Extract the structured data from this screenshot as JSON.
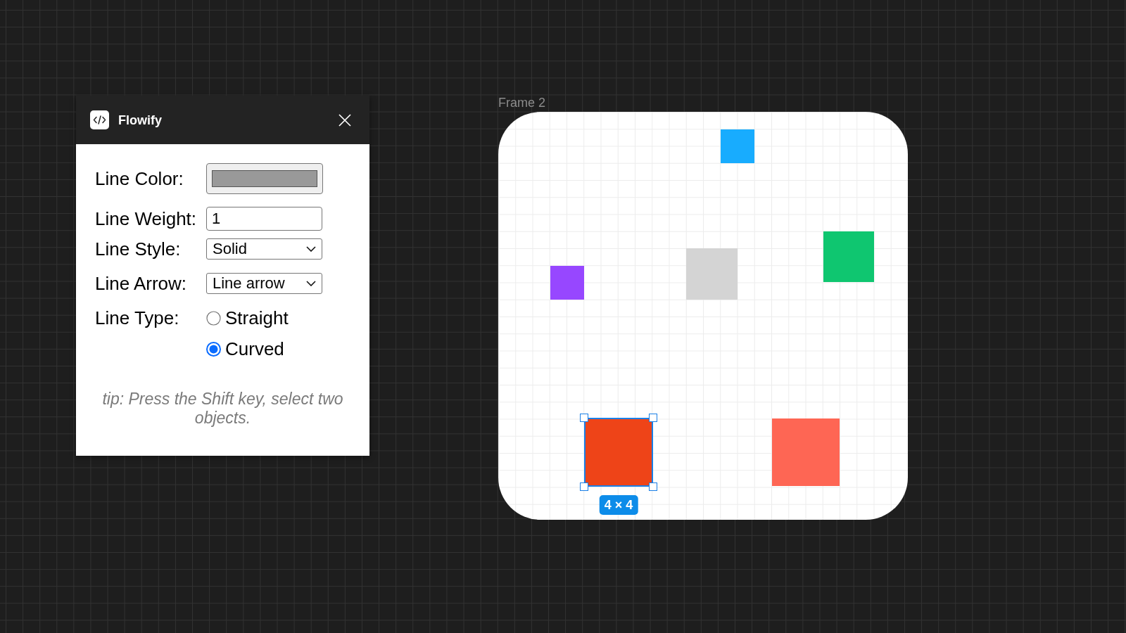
{
  "plugin_window": {
    "title": "Flowify",
    "fields": [
      {
        "kind": "color",
        "label": "Line Color:",
        "color": "#999999"
      },
      {
        "kind": "input",
        "label": "Line Weight:",
        "value": "1"
      },
      {
        "kind": "select",
        "label": "Line Style:",
        "value": "Solid"
      },
      {
        "kind": "select",
        "label": "Line Arrow:",
        "value": "Line arrow"
      },
      {
        "kind": "radio",
        "label": "Line Type:",
        "options": [
          {
            "label": "Straight",
            "selected": false
          },
          {
            "label": "Curved",
            "selected": true
          }
        ]
      }
    ],
    "tip": "tip: Press the Shift key, select two objects."
  },
  "frame": {
    "title": "Frame 2",
    "shapes": [
      {
        "color": "#18acfe",
        "selected": false
      },
      {
        "color": "#0fc670",
        "selected": false
      },
      {
        "color": "#d4d4d4",
        "selected": false
      },
      {
        "color": "#9747ff",
        "selected": false
      },
      {
        "color": "#ee4418",
        "selected": true
      },
      {
        "color": "#fe6654",
        "selected": false
      }
    ],
    "selection_label": "4 × 4"
  }
}
